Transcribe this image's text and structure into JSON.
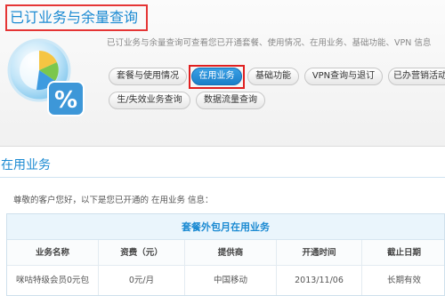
{
  "header": {
    "title": "已订业务与余量查询",
    "subtitle": "已订业务与余量查询可查看您已开通套餐、使用情况、在用业务、基础功能、VPN 信息",
    "tabs": [
      {
        "label": "套餐与使用情况",
        "active": false
      },
      {
        "label": "在用业务",
        "active": true
      },
      {
        "label": "基础功能",
        "active": false
      },
      {
        "label": "VPN查询与退订",
        "active": false
      },
      {
        "label": "已办营销活动",
        "active": false
      },
      {
        "label": "生/失效业务查询",
        "active": false
      },
      {
        "label": "数据流量查询",
        "active": false
      }
    ],
    "logo_symbol": "%"
  },
  "section": {
    "heading": "在用业务",
    "intro": "尊敬的客户您好，以下是您已开通的 在用业务 信息："
  },
  "table": {
    "caption": "套餐外包月在用业务",
    "columns": [
      "业务名称",
      "资费（元）",
      "提供商",
      "开通时间",
      "截止日期"
    ],
    "rows": [
      [
        "咪咕特级会员0元包",
        "0元/月",
        "中国移动",
        "2013/11/06",
        "长期有效"
      ]
    ]
  },
  "colors": {
    "accent": "#1b8ad2",
    "highlight": "#e53535",
    "active_tab": "#1a7fc9"
  }
}
